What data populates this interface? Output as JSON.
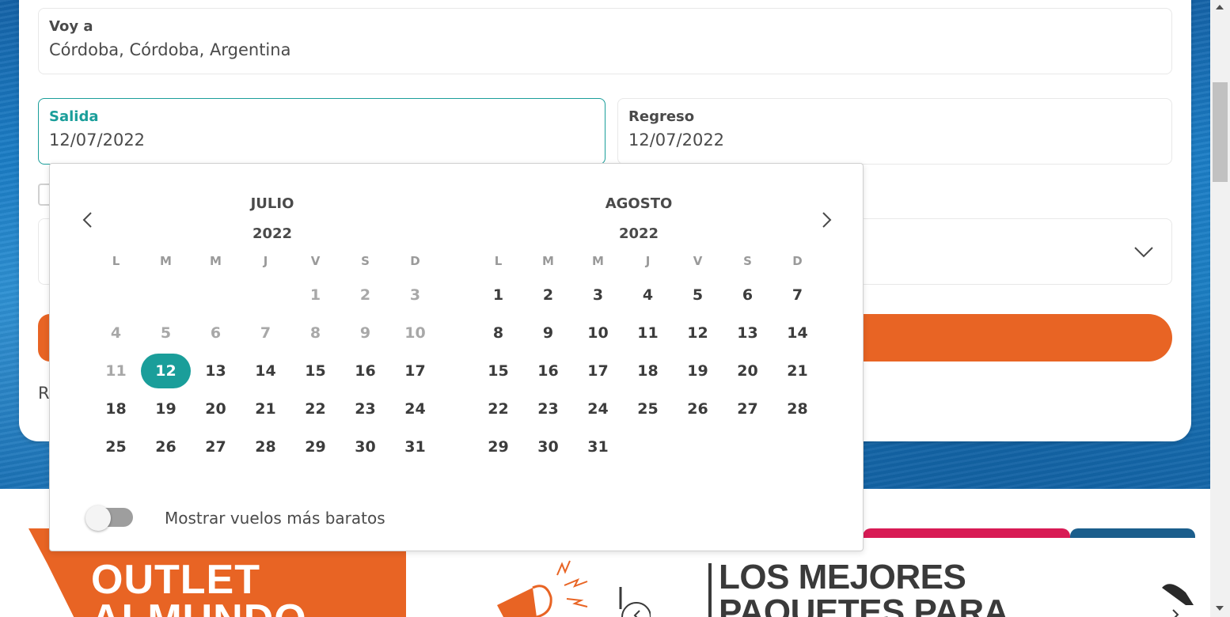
{
  "search": {
    "destination": {
      "label": "Voy a",
      "value": "Córdoba, Córdoba, Argentina"
    },
    "departure": {
      "label": "Salida",
      "value": "12/07/2022"
    },
    "return": {
      "label": "Regreso",
      "value": "12/07/2022"
    },
    "partial_text": "R"
  },
  "calendar": {
    "weekdays": [
      "L",
      "M",
      "M",
      "J",
      "V",
      "S",
      "D"
    ],
    "months": [
      {
        "name": "JULIO",
        "year": "2022",
        "weeks": [
          [
            "",
            "",
            "",
            "",
            "1",
            "2",
            "3"
          ],
          [
            "4",
            "5",
            "6",
            "7",
            "8",
            "9",
            "10"
          ],
          [
            "11",
            "12",
            "13",
            "14",
            "15",
            "16",
            "17"
          ],
          [
            "18",
            "19",
            "20",
            "21",
            "22",
            "23",
            "24"
          ],
          [
            "25",
            "26",
            "27",
            "28",
            "29",
            "30",
            "31"
          ]
        ],
        "disabled_through": 11,
        "selected": "12"
      },
      {
        "name": "AGOSTO",
        "year": "2022",
        "weeks": [
          [
            "1",
            "2",
            "3",
            "4",
            "5",
            "6",
            "7"
          ],
          [
            "8",
            "9",
            "10",
            "11",
            "12",
            "13",
            "14"
          ],
          [
            "15",
            "16",
            "17",
            "18",
            "19",
            "20",
            "21"
          ],
          [
            "22",
            "23",
            "24",
            "25",
            "26",
            "27",
            "28"
          ],
          [
            "29",
            "30",
            "31",
            "",
            "",
            "",
            ""
          ]
        ],
        "disabled_through": 0,
        "selected": ""
      }
    ],
    "cheapest_toggle": {
      "label": "Mostrar vuelos más baratos",
      "on": false
    }
  },
  "banners": {
    "outlet": "OUTLET\nALMUNDO",
    "paquetes": "LOS MEJORES\nPAQUETES PARA"
  },
  "colors": {
    "accent": "#1a9e9a",
    "cta": "#e86424",
    "pink": "#d81b55",
    "blue": "#1b5e8c"
  }
}
